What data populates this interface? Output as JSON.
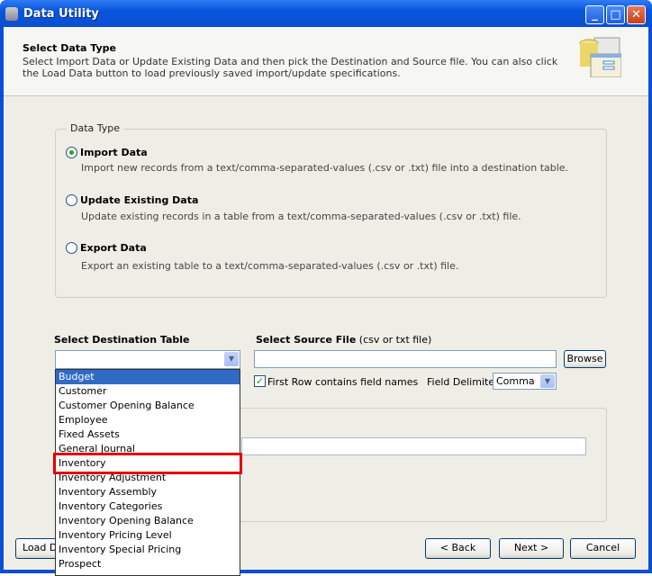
{
  "window": {
    "title": "Data Utility"
  },
  "header": {
    "title": "Select Data Type",
    "description": "Select Import Data or Update Existing Data and then pick the Destination and Source file.  You can also click the Load Data button to load previously saved import/update specifications."
  },
  "data_type": {
    "legend": "Data Type",
    "options": [
      {
        "label": "Import Data",
        "description": "Import new records from a text/comma-separated-values (.csv or .txt) file into a destination table.",
        "selected": true
      },
      {
        "label": "Update Existing Data",
        "description": "Update existing records in a table from a text/comma-separated-values (.csv or .txt) file.",
        "selected": false
      },
      {
        "label": "Export Data",
        "description": "Export an existing table to a text/comma-separated-values (.csv or .txt) file.",
        "selected": false
      }
    ]
  },
  "destination": {
    "label": "Select Destination Table",
    "value": "",
    "options": [
      "Budget",
      "Customer",
      "Customer Opening Balance",
      "Employee",
      "Fixed Assets",
      "General Journal",
      "Inventory",
      "Inventory Adjustment",
      "Inventory Assembly",
      "Inventory Categories",
      "Inventory Opening Balance",
      "Inventory Pricing Level",
      "Inventory Special Pricing",
      "Prospect"
    ],
    "highlighted": "Budget",
    "marked": "Inventory"
  },
  "source": {
    "label": "Select Source File",
    "hint": "(csv or txt file)",
    "value": "",
    "browse": "Browse",
    "first_row_label": "First Row contains field names",
    "first_row_checked": true,
    "delimiter_label": "Field Delimiter",
    "delimiter": "Comma"
  },
  "buttons": {
    "load": "Load Data",
    "back": "< Back",
    "next": "Next >",
    "cancel": "Cancel"
  }
}
